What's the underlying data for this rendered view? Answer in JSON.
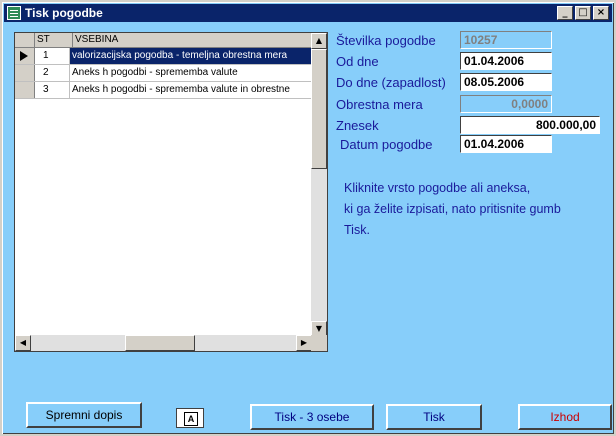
{
  "window": {
    "title": "Tisk pogodbe",
    "minimize": "_",
    "maximize": "□",
    "close": "×"
  },
  "grid": {
    "columns": [
      "ST",
      "VSEBINA"
    ],
    "rows": [
      {
        "st": "1",
        "vsebina": "valorizacijska pogodba  - temeljna obrestna mera",
        "selected": true
      },
      {
        "st": "2",
        "vsebina": "Aneks h pogodbi - sprememba valute",
        "selected": false
      },
      {
        "st": "3",
        "vsebina": "Aneks h pogodbi - sprememba valute in obrestne",
        "selected": false
      }
    ]
  },
  "form": {
    "stevilka_label": "Številka pogodbe",
    "stevilka_value": "10257",
    "od_dne_label": "Od dne",
    "od_dne_value": "01.04.2006",
    "do_dne_label": "Do dne (zapadlost)",
    "do_dne_value": "08.05.2006",
    "obrestna_label": "Obrestna mera",
    "obrestna_value": "0,0000",
    "znesek_label": "Znesek",
    "znesek_value": "800.000,00",
    "datum_label": "Datum pogodbe",
    "datum_value": "01.04.2006"
  },
  "info": {
    "line1": "Kliknite vrsto pogodbe ali aneksa,",
    "line2": "ki ga želite izpisati,  nato pritisnite gumb",
    "line3": "Tisk."
  },
  "buttons": {
    "spremni_dopis": "Spremni dopis",
    "tisk3": "Tisk - 3 osebe",
    "tisk": "Tisk",
    "izhod": "Izhod"
  },
  "colors": {
    "background": "#87cefa",
    "titlebar": "#0a246a",
    "label_text": "#1a1a9a",
    "exit_text": "#cc0000"
  }
}
